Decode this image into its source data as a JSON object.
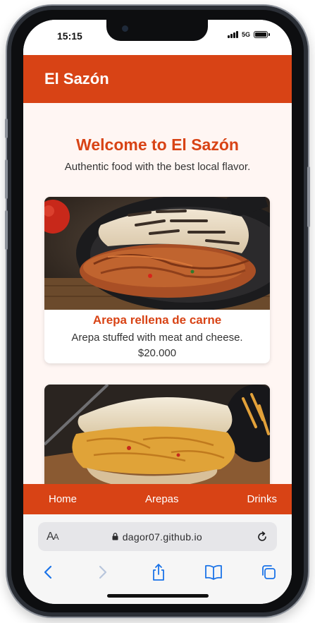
{
  "status_bar": {
    "time": "15:15",
    "network": "5G"
  },
  "header": {
    "title": "El Sazón"
  },
  "welcome": {
    "title": "Welcome to El Sazón",
    "subtitle": "Authentic food with the best local flavor."
  },
  "cards": [
    {
      "title": "Arepa rellena de carne",
      "description": "Arepa stuffed with meat and cheese.",
      "price": "$20.000"
    },
    {
      "title": "",
      "description": "",
      "price": ""
    }
  ],
  "bottom_nav": {
    "items": [
      {
        "label": "Home"
      },
      {
        "label": "Arepas"
      },
      {
        "label": "Drinks"
      }
    ]
  },
  "browser": {
    "url": "dagor07.github.io",
    "text_size_label": "AA"
  },
  "colors": {
    "brand": "#d84315",
    "page_bg": "#fff6f3"
  }
}
